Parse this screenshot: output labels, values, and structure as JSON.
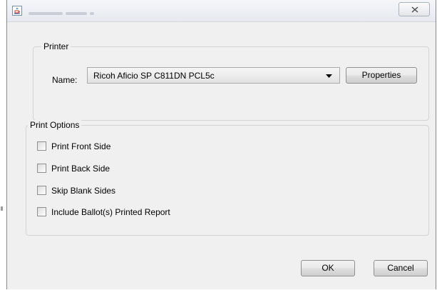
{
  "window": {
    "title_icon": "java-cup-icon",
    "close_icon": "close-icon"
  },
  "printer": {
    "group_label": "Printer",
    "name_label": "Name:",
    "selected_printer": "Ricoh Aficio SP C811DN PCL5c",
    "properties_label": "Properties"
  },
  "print_options": {
    "group_label": "Print Options",
    "items": [
      {
        "label": "Print Front Side",
        "checked": false
      },
      {
        "label": "Print Back Side",
        "checked": false
      },
      {
        "label": "Skip Blank Sides",
        "checked": false
      },
      {
        "label": "Include Ballot(s) Printed Report",
        "checked": false
      }
    ]
  },
  "buttons": {
    "ok": "OK",
    "cancel": "Cancel"
  }
}
